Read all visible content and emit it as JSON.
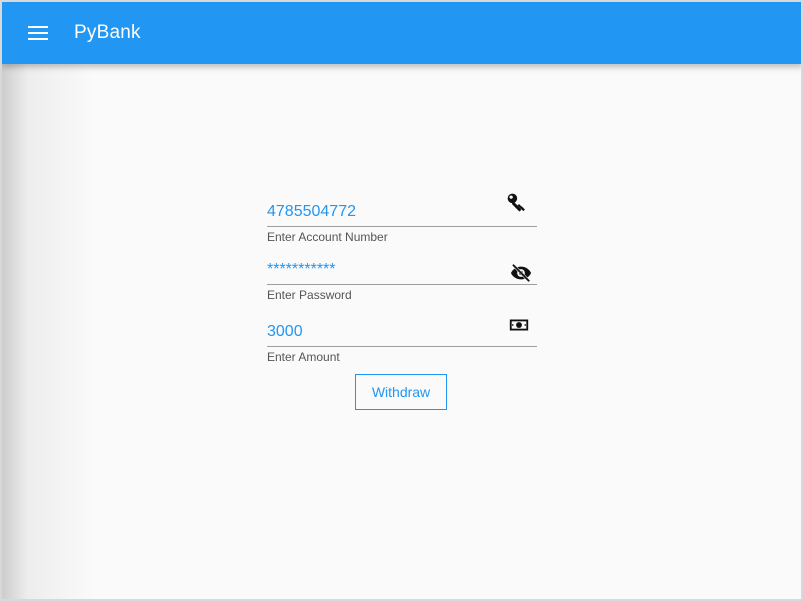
{
  "app_bar": {
    "title": "PyBank",
    "menu_icon": "menu-icon",
    "color": "#2196f3"
  },
  "form": {
    "account": {
      "value": "4785504772",
      "label": "Enter Account Number",
      "icon": "key-icon"
    },
    "password": {
      "value": "***********",
      "label": "Enter Password",
      "icon": "eye-off-icon"
    },
    "amount": {
      "value": "3000",
      "label": "Enter Amount",
      "icon": "cash-icon"
    },
    "withdraw_label": "Withdraw"
  },
  "colors": {
    "accent": "#2196f3",
    "background": "#fafafa",
    "icon": "#111111"
  }
}
